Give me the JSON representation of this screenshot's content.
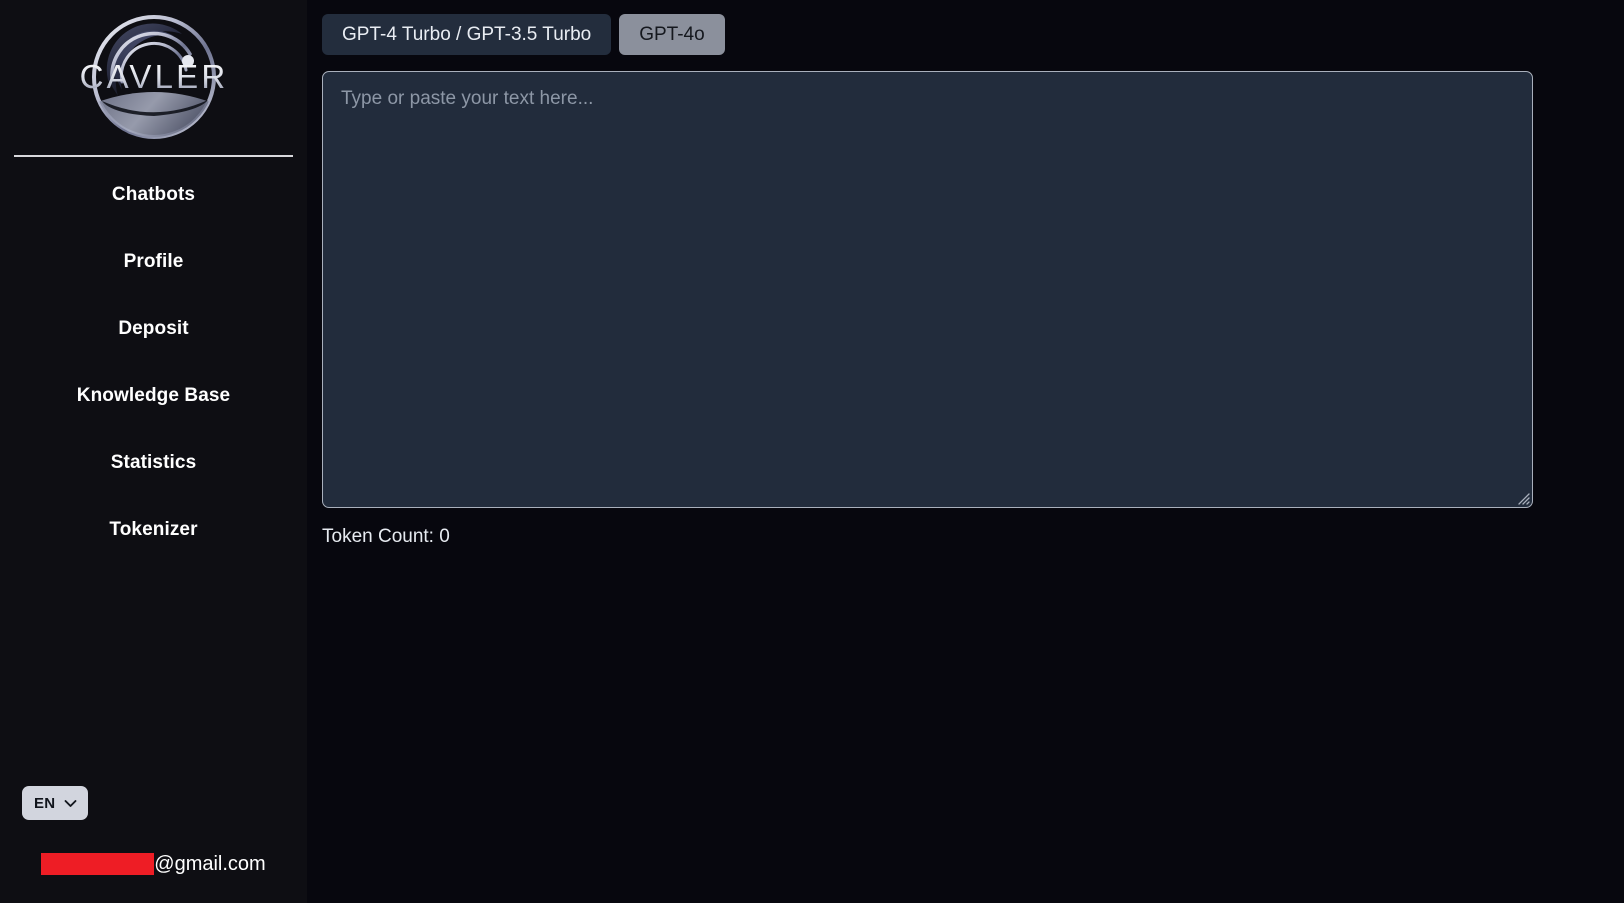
{
  "brand": {
    "name": "CAVLER",
    "logo_icon": "cavler-circular-emblem-logo"
  },
  "sidebar": {
    "items": [
      {
        "label": "Chatbots",
        "name": "chatbots"
      },
      {
        "label": "Profile",
        "name": "profile"
      },
      {
        "label": "Deposit",
        "name": "deposit"
      },
      {
        "label": "Knowledge Base",
        "name": "knowledge-base"
      },
      {
        "label": "Statistics",
        "name": "statistics"
      },
      {
        "label": "Tokenizer",
        "name": "tokenizer"
      }
    ],
    "language": {
      "selected": "EN",
      "chevron_icon": "chevron-down-icon"
    },
    "account": {
      "email_local_redacted": "",
      "email_domain": "@gmail.com",
      "redaction_color": "#ee1d25"
    }
  },
  "main": {
    "tabs": [
      {
        "label": "GPT-4 Turbo / GPT-3.5 Turbo",
        "name": "gpt4-turbo-gpt35-turbo",
        "active": true
      },
      {
        "label": "GPT-4o",
        "name": "gpt4o",
        "active": false
      }
    ],
    "editor": {
      "placeholder": "Type or paste your text here...",
      "value": "",
      "resize_icon": "resize-grip-icon"
    },
    "token_count_label": "Token Count: 0"
  },
  "colors": {
    "sidebar_bg": "#0e0e13",
    "main_bg": "#07070e",
    "editor_bg": "#222c3c",
    "editor_border": "#a9b0bc",
    "tab_active_bg": "#232d3d",
    "tab_inactive_bg": "#8b909c",
    "text_primary": "#ffffff",
    "placeholder": "#8d97a6",
    "lang_bg": "#d2d5de"
  }
}
